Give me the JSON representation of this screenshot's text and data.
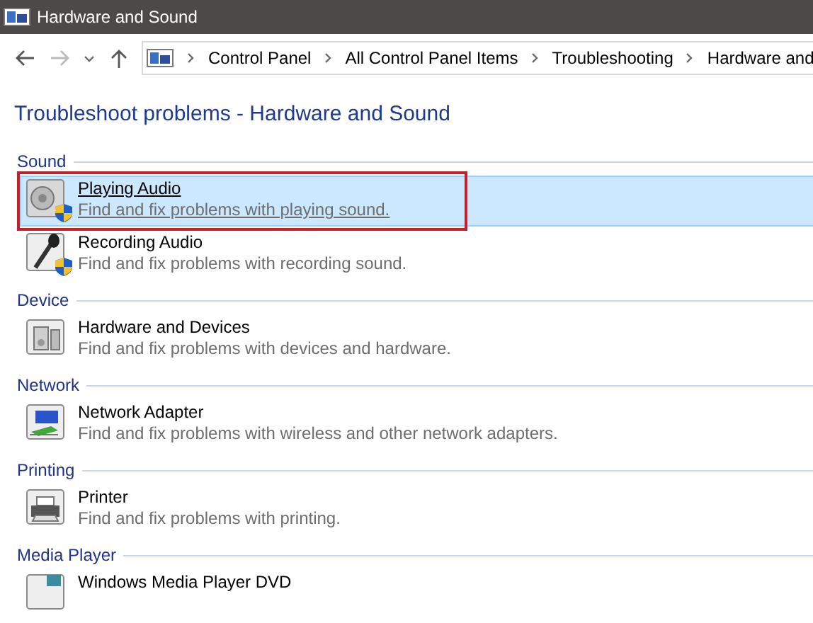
{
  "window": {
    "title": "Hardware and Sound"
  },
  "breadcrumb": [
    "Control Panel",
    "All Control Panel Items",
    "Troubleshooting",
    "Hardware and"
  ],
  "heading": "Troubleshoot problems - Hardware and Sound",
  "sections": [
    {
      "label": "Sound",
      "items": [
        {
          "kind": "speaker",
          "title": "Playing Audio",
          "description": "Find and fix problems with playing sound.",
          "selected": true,
          "outlined": true,
          "shield": true
        },
        {
          "kind": "microphone",
          "title": "Recording Audio",
          "description": "Find and fix problems with recording sound.",
          "selected": false,
          "outlined": false,
          "shield": true
        }
      ]
    },
    {
      "label": "Device",
      "items": [
        {
          "kind": "hardware",
          "title": "Hardware and Devices",
          "description": "Find and fix problems with devices and hardware.",
          "selected": false,
          "outlined": false,
          "shield": false
        }
      ]
    },
    {
      "label": "Network",
      "items": [
        {
          "kind": "network",
          "title": "Network Adapter",
          "description": "Find and fix problems with wireless and other network adapters.",
          "selected": false,
          "outlined": false,
          "shield": false
        }
      ]
    },
    {
      "label": "Printing",
      "items": [
        {
          "kind": "printer",
          "title": "Printer",
          "description": "Find and fix problems with printing.",
          "selected": false,
          "outlined": false,
          "shield": false
        }
      ]
    },
    {
      "label": "Media Player",
      "items": [
        {
          "kind": "media",
          "title": "Windows Media Player DVD",
          "selected": false,
          "outlined": false,
          "shield": false
        }
      ]
    }
  ]
}
